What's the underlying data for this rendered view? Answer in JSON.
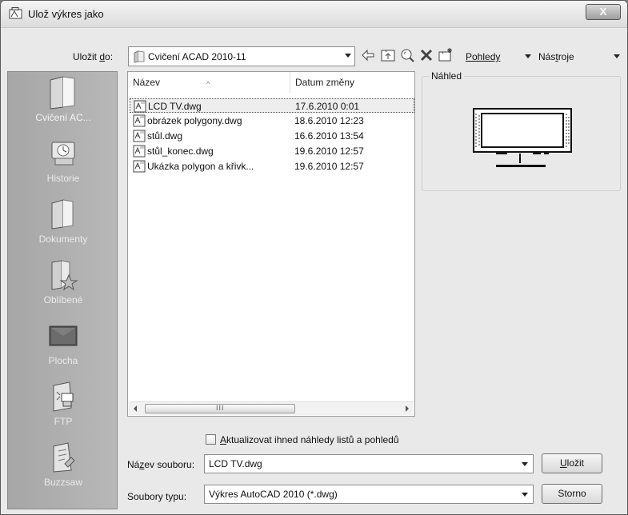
{
  "window": {
    "title": "Ulož výkres jako",
    "close_label": "X"
  },
  "toolbar": {
    "save_in_label_pre": "Uložit ",
    "save_in_label_key": "d",
    "save_in_label_post": "o:",
    "current_folder": "Cvičení ACAD 2010-11",
    "views_label": "Pohledy",
    "tools_label_pre": "Nás",
    "tools_label_key": "t",
    "tools_label_post": "roje"
  },
  "places": [
    {
      "label": "Cvičení AC...",
      "icon": "folder-icon",
      "selected": true
    },
    {
      "label": "Historie",
      "icon": "history-icon"
    },
    {
      "label": "Dokumenty",
      "icon": "documents-folder-icon"
    },
    {
      "label": "Oblíbené",
      "icon": "favorites-icon"
    },
    {
      "label": "Plocha",
      "icon": "desktop-icon"
    },
    {
      "label": "FTP",
      "icon": "ftp-icon"
    },
    {
      "label": "Buzzsaw",
      "icon": "buzzsaw-icon"
    }
  ],
  "filelist": {
    "columns": [
      "Název",
      "Datum změny"
    ],
    "rows": [
      {
        "name": "LCD TV.dwg",
        "date": "17.6.2010 0:01",
        "selected": true
      },
      {
        "name": "obrázek polygony.dwg",
        "date": "18.6.2010 12:23"
      },
      {
        "name": "stůl.dwg",
        "date": "16.6.2010 13:54"
      },
      {
        "name": "stůl_konec.dwg",
        "date": "19.6.2010 12:57"
      },
      {
        "name": "Ukázka polygon a křivk...",
        "date": "19.6.2010 12:57"
      }
    ],
    "scroll_grip": "III"
  },
  "preview": {
    "label": "Náhled"
  },
  "checkbox": {
    "label_key": "A",
    "label_rest": "ktualizovat ihned náhledy listů a pohledů",
    "checked": false
  },
  "filename": {
    "label_pre": "Ná",
    "label_key": "z",
    "label_post": "ev souboru:",
    "value": "LCD TV.dwg"
  },
  "filetype": {
    "label": "Soubory typu:",
    "value": "Výkres AutoCAD 2010 (*.dwg)"
  },
  "buttons": {
    "save_key": "U",
    "save_rest": "ložit",
    "cancel": "Storno"
  }
}
